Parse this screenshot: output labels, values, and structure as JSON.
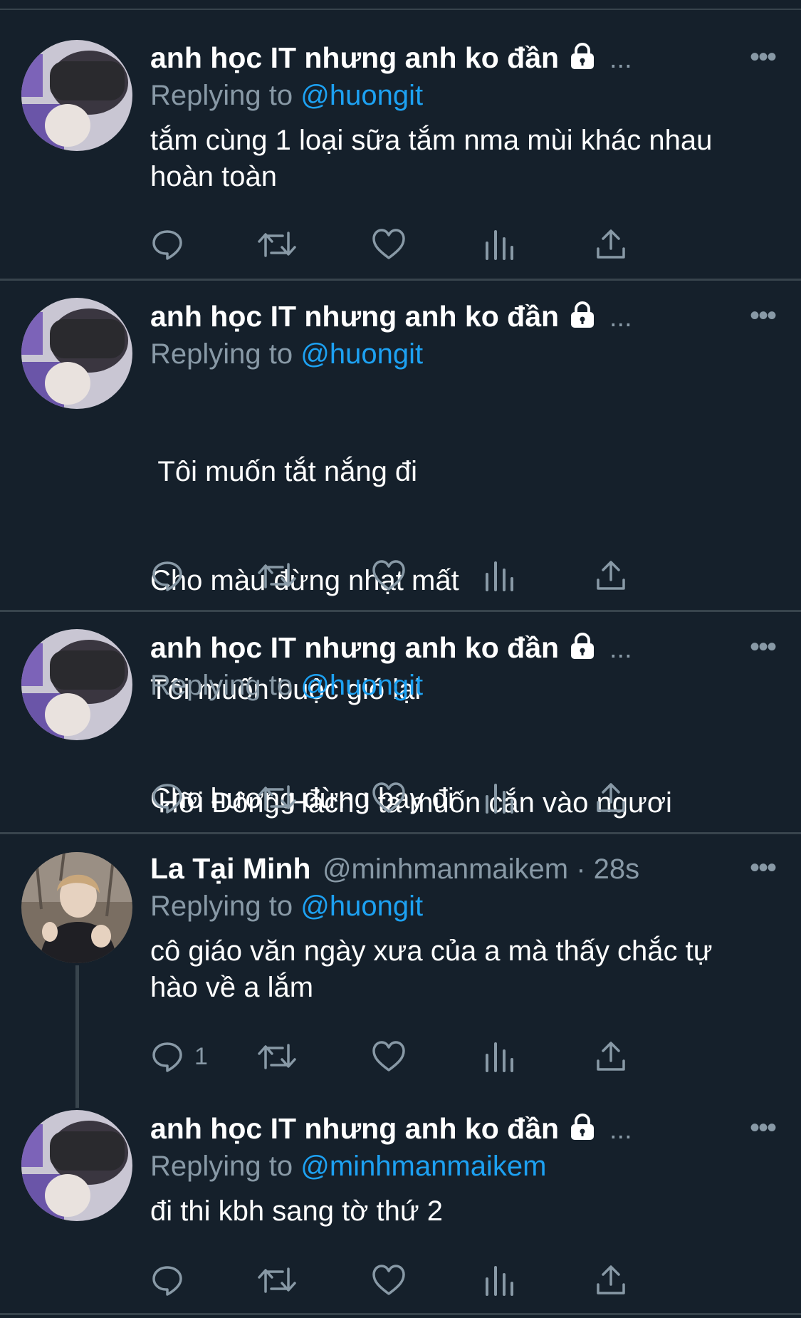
{
  "tweets": [
    {
      "author": "anh học IT nhưng anh ko đần",
      "locked": true,
      "truncated": "...",
      "handle": "",
      "time": "",
      "replying_label": "Replying to",
      "replying_to": "@huongit",
      "lines": [
        "tắm cùng 1 loại sữa tắm nma mùi khác nhau",
        "hoàn toàn"
      ],
      "reply_count": ""
    },
    {
      "author": "anh học IT nhưng anh ko đần",
      "locked": true,
      "truncated": "...",
      "handle": "",
      "time": "",
      "replying_label": "Replying to",
      "replying_to": "@huongit",
      "lines": [
        " Tôi muốn tắt nắng đi",
        "Cho màu đừng nhạt mất",
        "Tôi muốn buộc gió lại",
        "Cho hương đừng bay đi"
      ],
      "reply_count": ""
    },
    {
      "author": "anh học IT nhưng anh ko đần",
      "locked": true,
      "truncated": "...",
      "handle": "",
      "time": "",
      "replying_label": "Replying to",
      "replying_to": "@huongit",
      "lines": [
        " Hỡi Đông Hách ! ta muốn cắn vào ngươi"
      ],
      "reply_count": ""
    },
    {
      "author": "La Tại Minh",
      "locked": false,
      "truncated": "",
      "handle": "@minhmanmaikem · 28s",
      "time": "",
      "replying_label": "Replying to",
      "replying_to": "@huongit",
      "lines": [
        "cô giáo văn ngày xưa của a mà thấy chắc tự",
        "hào về a lắm"
      ],
      "reply_count": "1"
    },
    {
      "author": "anh học IT nhưng anh ko đần",
      "locked": true,
      "truncated": "...",
      "handle": "",
      "time": "",
      "replying_label": "Replying to",
      "replying_to": "@minhmanmaikem",
      "lines": [
        "đi thi kbh sang tờ thứ 2"
      ],
      "reply_count": ""
    }
  ],
  "more_glyph": "•••",
  "icons": [
    "reply-icon",
    "retweet-icon",
    "like-icon",
    "analytics-icon",
    "share-icon",
    "lock-icon",
    "more-icon"
  ],
  "colors": {
    "background": "#15202b",
    "divider": "#38444d",
    "muted": "#8899a6",
    "link": "#1da1f2",
    "text": "#ffffff"
  }
}
